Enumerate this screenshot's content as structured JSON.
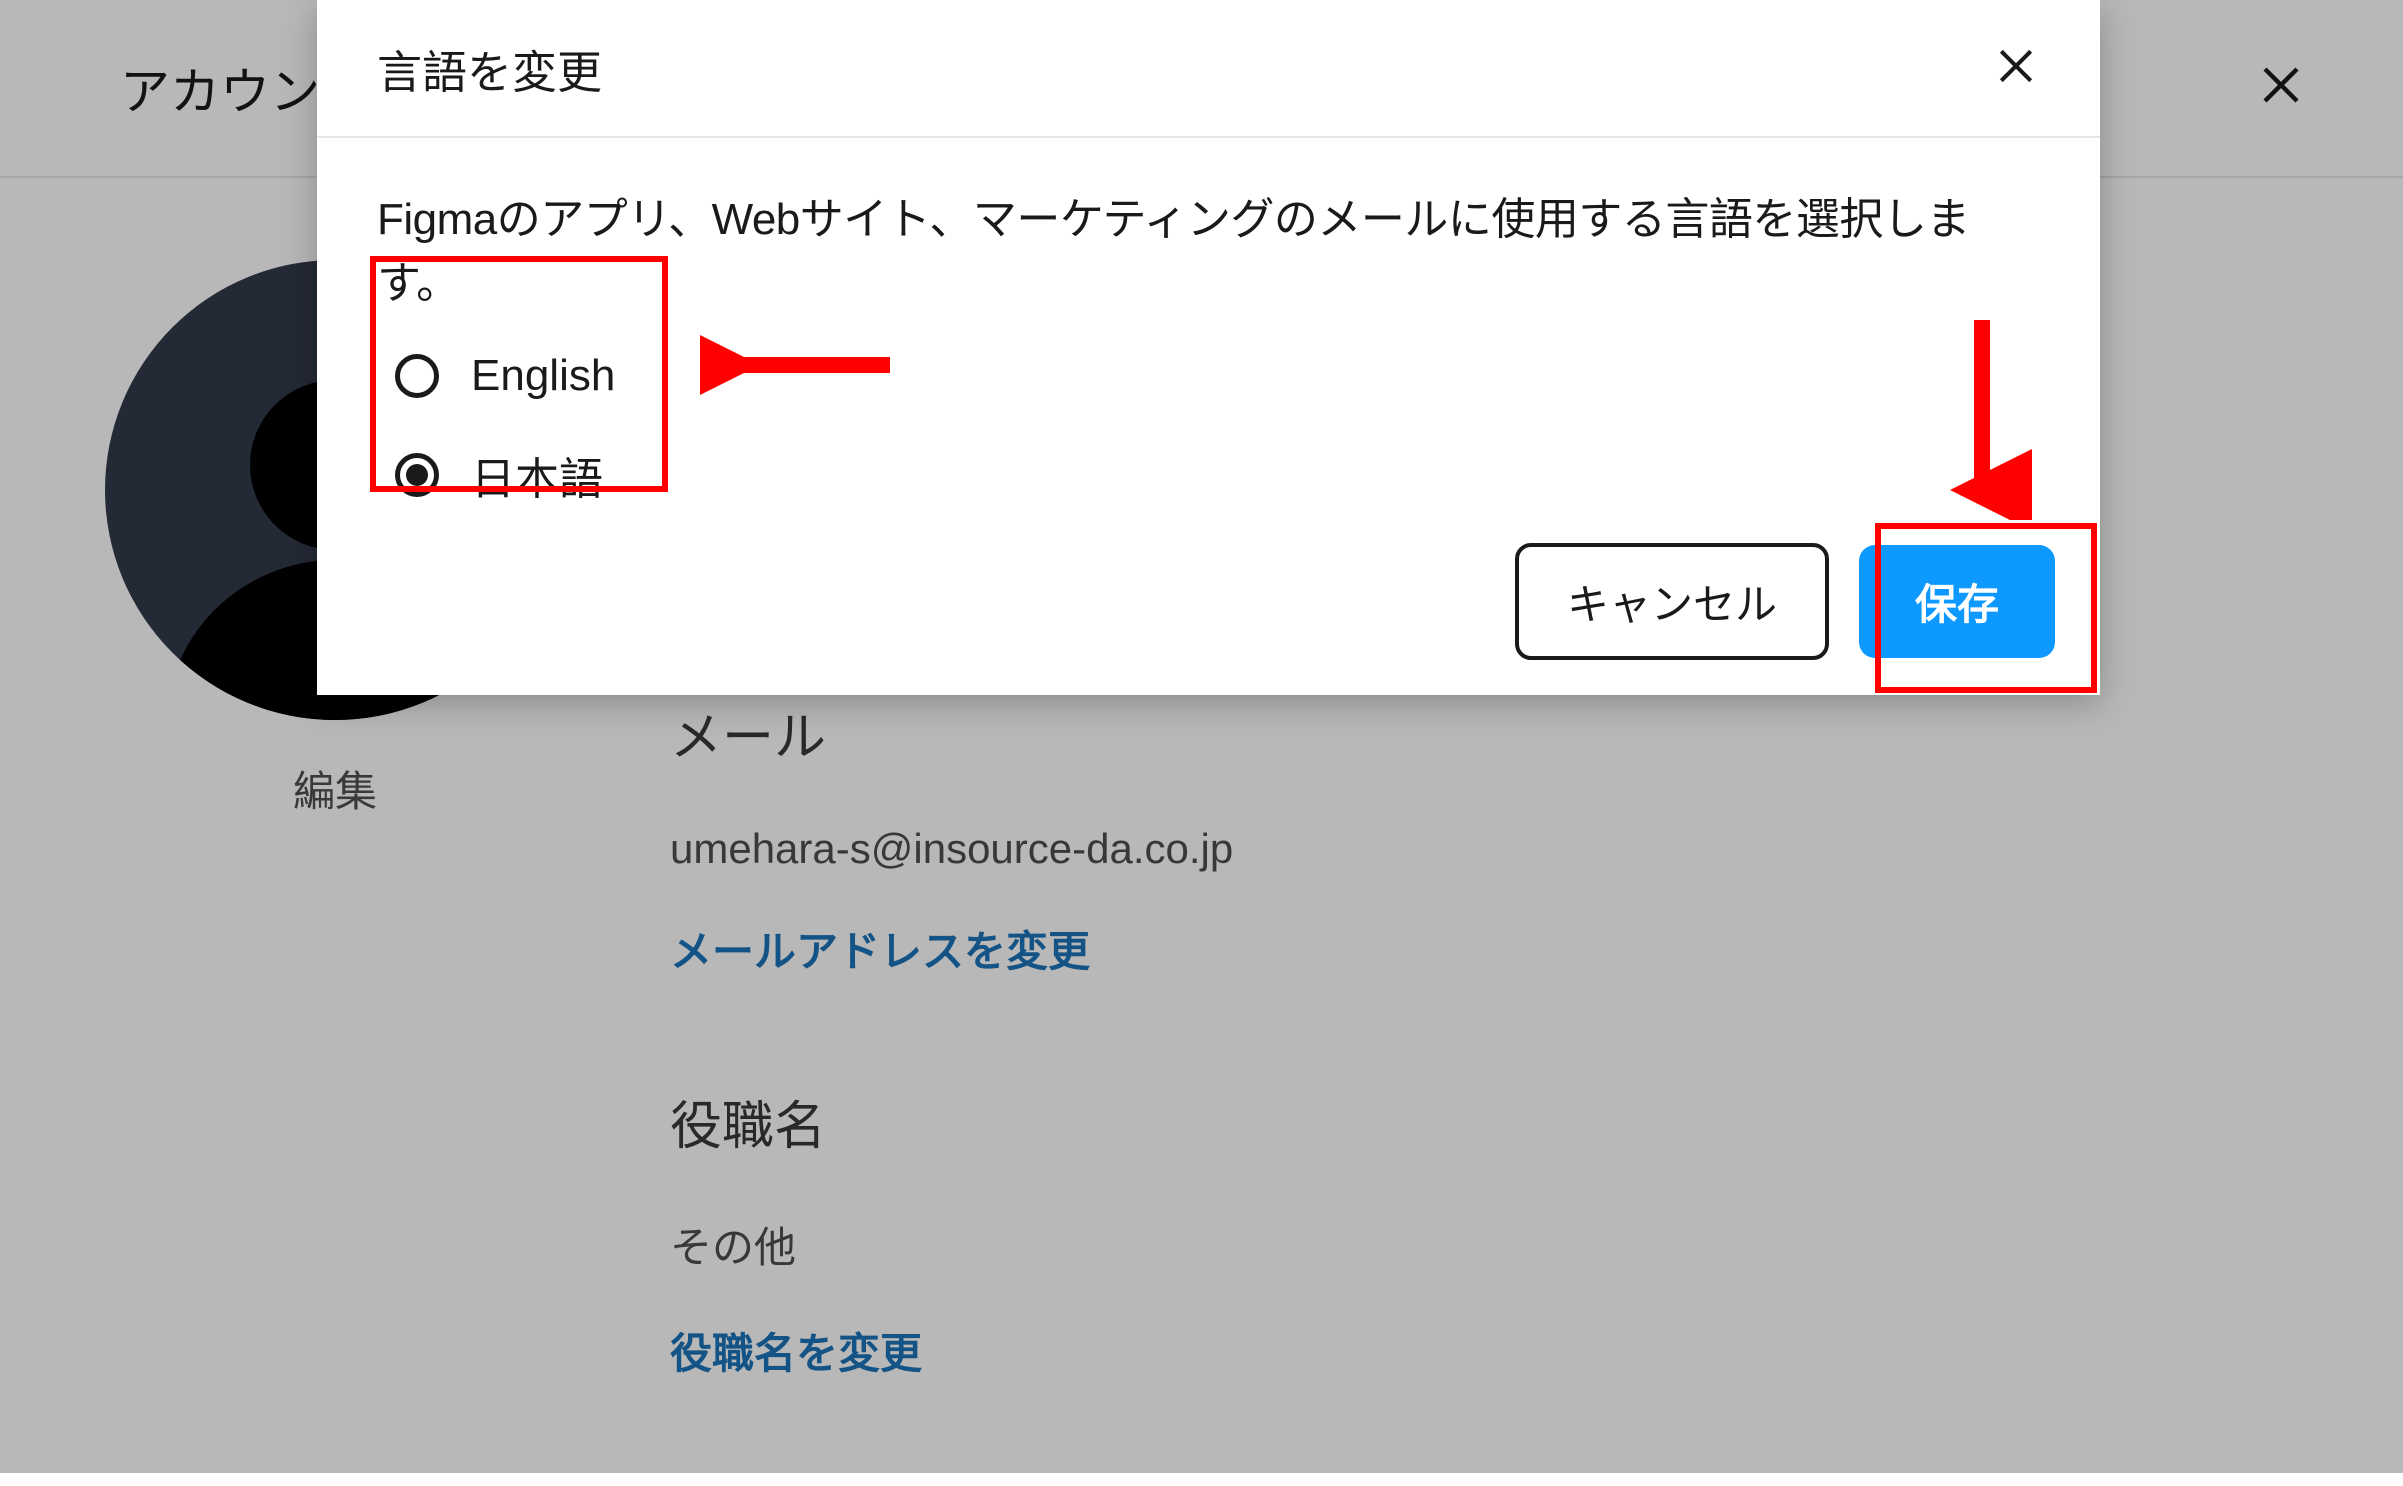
{
  "background": {
    "header_title": "アカウン",
    "profile": {
      "edit_label": "編集"
    },
    "email_section": {
      "title": "メール",
      "value": "umehara-s@insource-da.co.jp",
      "change_link": "メールアドレスを変更"
    },
    "title_section": {
      "title": "役職名",
      "value": "その他",
      "change_link": "役職名を変更"
    }
  },
  "modal": {
    "title": "言語を変更",
    "description": "Figmaのアプリ、Webサイト、マーケティングのメールに使用する言語を選択します。",
    "options": [
      {
        "label": "English",
        "selected": false
      },
      {
        "label": "日本語",
        "selected": true
      }
    ],
    "buttons": {
      "cancel": "キャンセル",
      "save": "保存"
    }
  }
}
